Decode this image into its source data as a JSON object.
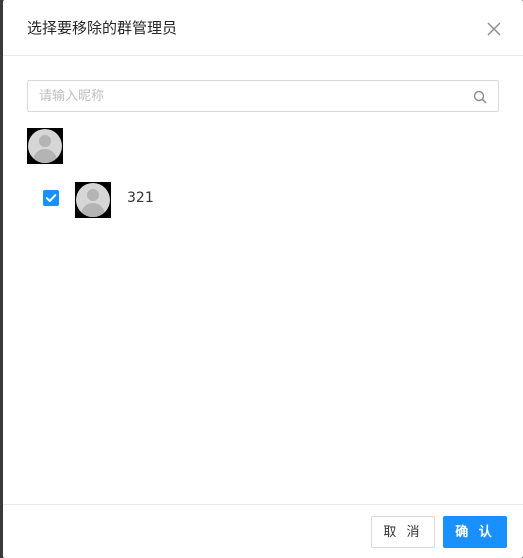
{
  "dialog": {
    "title": "选择要移除的群管理员",
    "close_icon": "close-icon"
  },
  "search": {
    "placeholder": "请输入昵称",
    "value": "",
    "icon": "search-icon"
  },
  "group": {
    "avatar_icon": "avatar-icon"
  },
  "members": [
    {
      "name": "321",
      "checked": true,
      "avatar_icon": "avatar-icon"
    }
  ],
  "footer": {
    "cancel_label": "取 消",
    "confirm_label": "确 认"
  },
  "colors": {
    "primary": "#1890ff",
    "border": "#d9d9d9",
    "placeholder": "#bfbfbf"
  }
}
